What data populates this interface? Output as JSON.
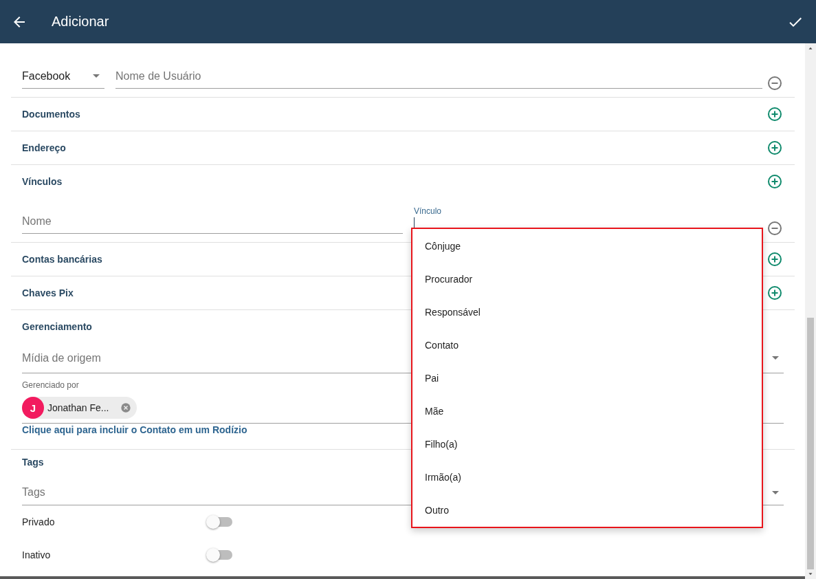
{
  "header": {
    "title": "Adicionar"
  },
  "sections": [
    {
      "kind": "social",
      "network": "Facebook",
      "placeholder": "Nome de Usuário"
    },
    {
      "kind": "collapsed",
      "title": "Documentos"
    },
    {
      "kind": "collapsed",
      "title": "Endereço"
    },
    {
      "kind": "relation",
      "title": "Vínculos",
      "name_placeholder": "Nome",
      "relation_label": "Vínculo"
    },
    {
      "kind": "collapsed",
      "title": "Contas bancárias"
    },
    {
      "kind": "collapsed",
      "title": "Chaves Pix"
    },
    {
      "kind": "management",
      "title": "Gerenciamento",
      "origin_placeholder": "Mídia de origem",
      "managed_label": "Gerenciado por",
      "chip": {
        "initial": "J",
        "name": "Jonathan Fe..."
      },
      "link": "Clique aqui para incluir o Contato em um Rodízio"
    },
    {
      "kind": "tags",
      "title": "Tags",
      "placeholder": "Tags"
    }
  ],
  "switches": [
    {
      "label": "Privado",
      "on": false
    },
    {
      "label": "Inativo",
      "on": false
    }
  ],
  "dropdown": {
    "options": [
      "Cônjuge",
      "Procurador",
      "Responsável",
      "Contato",
      "Pai",
      "Mãe",
      "Filho(a)",
      "Irmão(a)",
      "Outro"
    ]
  }
}
